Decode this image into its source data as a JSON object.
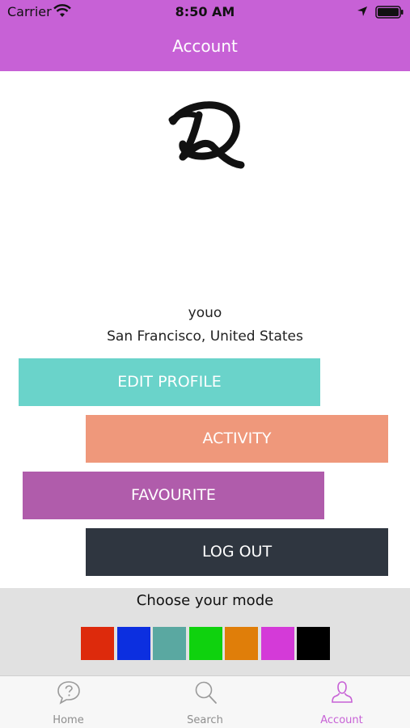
{
  "status_bar": {
    "carrier": "Carrier",
    "time": "8:50 AM"
  },
  "header": {
    "title": "Account",
    "color": "#c761d6"
  },
  "profile": {
    "logo_icon": "q-script-logo",
    "username": "youo",
    "location": "San Francisco, United States"
  },
  "menu": {
    "edit_profile": "EDIT PROFILE",
    "activity": "ACTIVITY",
    "favourite": "FAVOURITE",
    "log_out": "LOG OUT",
    "colors": {
      "edit_profile": "#6ad3ca",
      "activity": "#ef987b",
      "favourite": "#b05cab",
      "log_out": "#2f3640"
    }
  },
  "mode": {
    "title": "Choose your mode",
    "swatches": [
      "#dd2a0c",
      "#0c2fe0",
      "#5aa8a1",
      "#0fd20e",
      "#e07e09",
      "#d43ad8",
      "#000000"
    ]
  },
  "tab_bar": {
    "home": "Home",
    "search": "Search",
    "account": "Account",
    "active": "account"
  }
}
